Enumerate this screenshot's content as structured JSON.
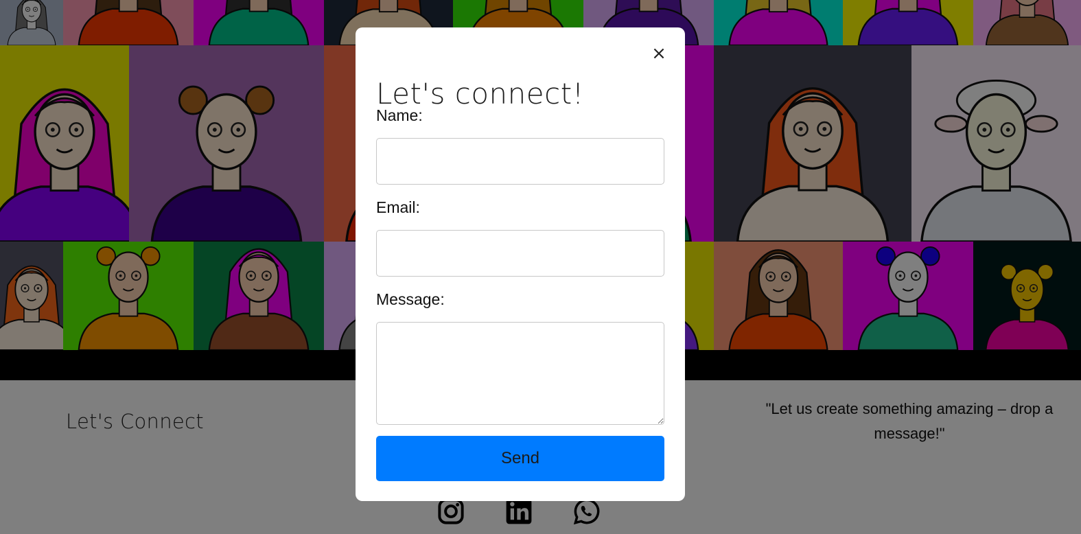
{
  "background": {
    "grid_rows": [
      [
        {
          "bg": "#b0bdd0",
          "skin": "#ffffff",
          "hair": "#777777",
          "shirt": "#c9d3e1",
          "kind": "person"
        },
        {
          "bg": "#ff9bb4",
          "skin": "#ffd4b4",
          "hair": "#5a3a1a",
          "shirt": "#ff3b00",
          "kind": "person"
        },
        {
          "bg": "#ff00ff",
          "skin": "#ffd4b4",
          "hair": "#333333",
          "shirt": "#00c68e",
          "kind": "person"
        },
        {
          "bg": "#1e2b3d",
          "skin": "#ffd4b4",
          "hair": "#e24e12",
          "shirt": "#ffe1b8",
          "kind": "person"
        },
        {
          "bg": "#37f007",
          "skin": "#ffd4b4",
          "hair": "#e08a00",
          "shirt": "#ff8800",
          "kind": "person"
        },
        {
          "bg": "#e0b0ff",
          "skin": "#ffd4b4",
          "hair": "#5d1aaa",
          "shirt": "#5a14b0",
          "kind": "person"
        },
        {
          "bg": "#00fbe0",
          "skin": "#ffd4b4",
          "hair": "#f0cf2a",
          "shirt": "#ff00ff",
          "kind": "person"
        },
        {
          "bg": "#fffc00",
          "skin": "#ffd4b4",
          "hair": "#ff00ff",
          "shirt": "#6b1fff",
          "kind": "person"
        },
        {
          "bg": "#ffb4ff",
          "skin": "#ffd4b4",
          "hair": "#f07a8a",
          "shirt": "#a06a3a",
          "kind": "person"
        }
      ],
      [
        {
          "bg": "#f2f200",
          "skin": "#ffe8d0",
          "hair": "#ff00d4",
          "shirt": "#8b00ff",
          "kind": "person"
        },
        {
          "bg": "#a86ab8",
          "skin": "#ffe8d0",
          "hair": "#b06820",
          "shirt": "#3c0090",
          "kind": "bear"
        },
        {
          "bg": "#ff6f4a",
          "skin": "#ffe8d0",
          "hair": "#c04020",
          "shirt": "#ff2b00",
          "kind": "person"
        },
        {
          "bg": "#ff00ff",
          "skin": "#ffe8d0",
          "hair": "#ff00ff",
          "shirt": "#00a060",
          "kind": "person"
        },
        {
          "bg": "#444455",
          "skin": "#ffe8d0",
          "hair": "#ff5a1a",
          "shirt": "#fff0e0",
          "kind": "person"
        },
        {
          "bg": "#fff0ff",
          "skin": "#fffde0",
          "hair": "#ffffff",
          "shirt": "#e8ecf4",
          "kind": "sheep"
        }
      ],
      [
        {
          "bg": "#555566",
          "skin": "#ffe8d0",
          "hair": "#ff6a1a",
          "shirt": "#fff0e0",
          "kind": "person"
        },
        {
          "bg": "#5cff00",
          "skin": "#ffd4b4",
          "hair": "#ff9900",
          "shirt": "#ff9900",
          "kind": "cat"
        },
        {
          "bg": "#0a8a4a",
          "skin": "#ffd4b4",
          "hair": "#ff00ff",
          "shirt": "#a0522d",
          "kind": "person"
        },
        {
          "bg": "#e0b0ff",
          "skin": "#ffd4b4",
          "hair": "#444444",
          "shirt": "#888888",
          "kind": "person"
        },
        {
          "bg": "#ff3ab0",
          "skin": "#ffd4b4",
          "hair": "#333333",
          "shirt": "#ff6600",
          "kind": "person"
        },
        {
          "bg": "#f2ee00",
          "skin": "#ffd4b4",
          "hair": "#666666",
          "shirt": "#8833ff",
          "kind": "person"
        },
        {
          "bg": "#ff9a78",
          "skin": "#ffd4b4",
          "hair": "#6b3a12",
          "shirt": "#ff4a00",
          "kind": "person"
        },
        {
          "bg": "#ff00ff",
          "skin": "#ffffff",
          "hair": "#1a00ff",
          "shirt": "#20c090",
          "kind": "bear"
        },
        {
          "bg": "#001a1a",
          "skin": "#ffcc00",
          "hair": "#ffcc00",
          "shirt": "#ff00aa",
          "kind": "giraffe"
        }
      ]
    ]
  },
  "footer": {
    "title": "Let's Connect",
    "quote": "\"Let us create something amazing – drop a message!\"",
    "social": [
      {
        "icon": "instagram-icon"
      },
      {
        "icon": "linkedin-icon"
      },
      {
        "icon": "whatsapp-icon"
      }
    ]
  },
  "modal": {
    "title": "Let's connect!",
    "close_label": "×",
    "name_label": "Name:",
    "name_value": "",
    "email_label": "Email:",
    "email_value": "",
    "message_label": "Message:",
    "message_value": "",
    "send_label": "Send"
  },
  "colors": {
    "accent": "#007bff",
    "overlay": "rgba(0,0,0,0.5)"
  }
}
